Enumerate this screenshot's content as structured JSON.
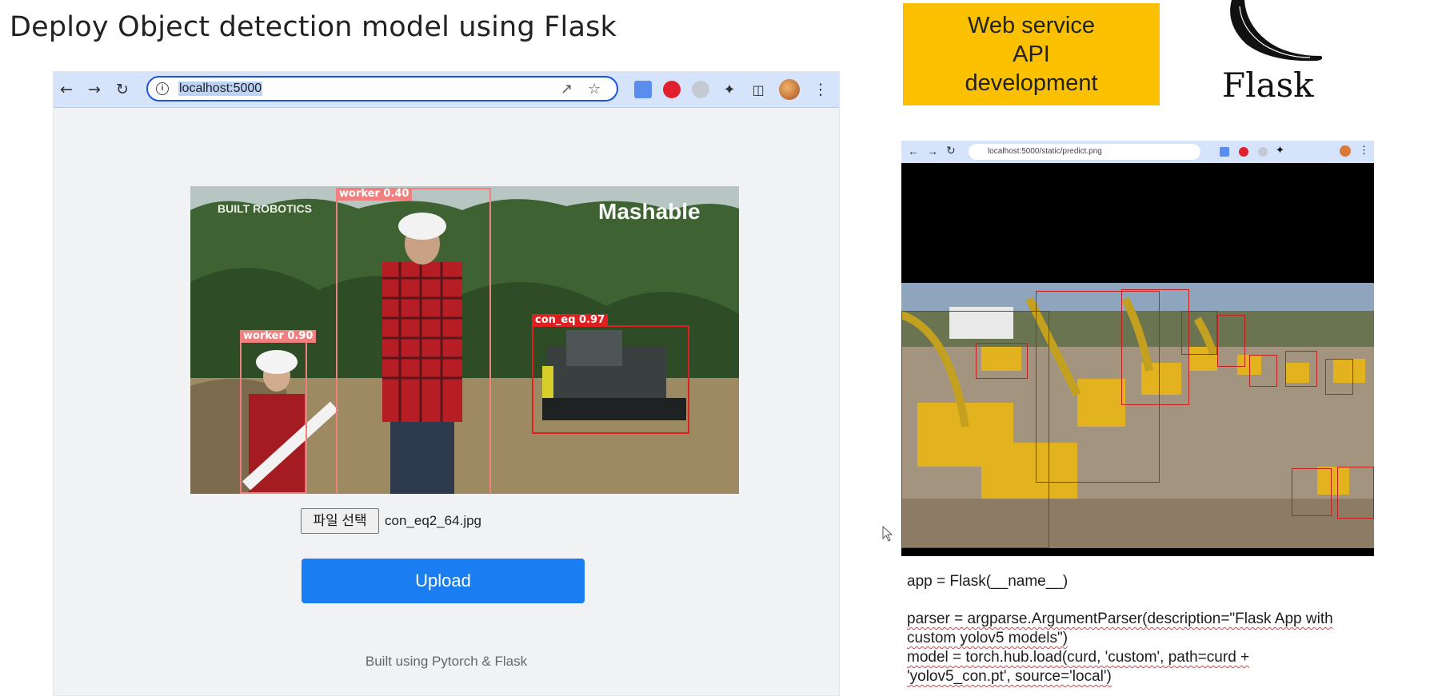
{
  "slide": {
    "title": "Deploy Object detection model using Flask",
    "tag_lines": [
      "Web service",
      "API",
      "development"
    ],
    "flask_word": "Flask"
  },
  "left_browser": {
    "url": "localhost:5000",
    "detections": [
      {
        "label": "worker 0.40",
        "color": "#f08080"
      },
      {
        "label": "worker 0.90",
        "color": "#f08080"
      },
      {
        "label": "con_eq 0.97",
        "color": "#e02020"
      }
    ],
    "watermarks": {
      "top_left": "BUILT ROBOTICS",
      "top_right": "Mashable"
    },
    "file_button": "파일 선택",
    "file_name": "con_eq2_64.jpg",
    "upload_label": "Upload",
    "footer": "Built using Pytorch & Flask",
    "accent": "#1a7ef2"
  },
  "right_browser": {
    "url": "localhost:5000/static/predict.png"
  },
  "code": {
    "line1": "app = Flask(__name__)",
    "line2a": "parser = argparse.ArgumentParser(description=\"Flask App with",
    "line2b": "custom yolov5 models\")",
    "line3a": "model = torch.hub.load(curd, 'custom', path=curd +",
    "line3b": "'yolov5_con.pt', source='local')"
  },
  "icons": [
    "back-arrow-icon",
    "forward-arrow-icon",
    "reload-icon",
    "info-icon",
    "share-icon",
    "star-icon",
    "extensions-icon",
    "menu-kebab-icon",
    "cursor-icon"
  ]
}
